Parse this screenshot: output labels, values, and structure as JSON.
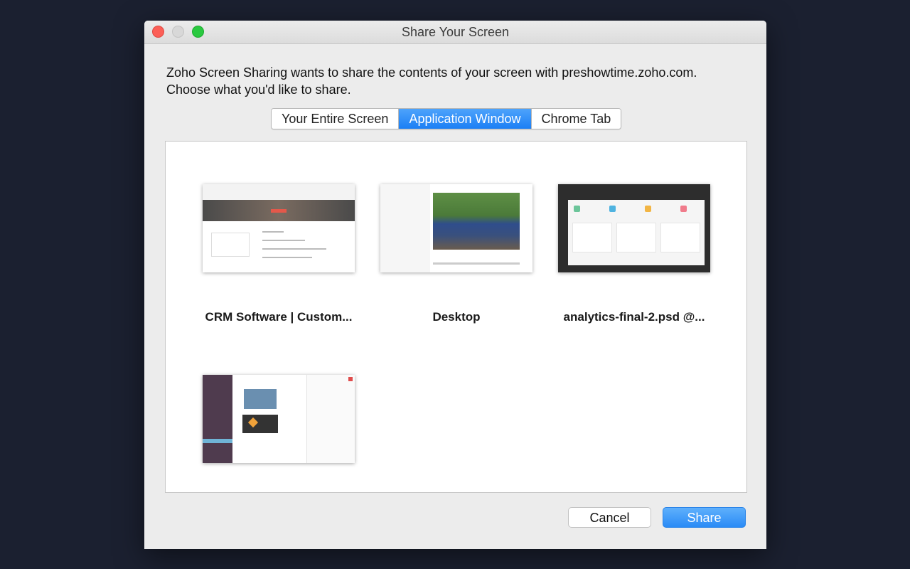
{
  "window": {
    "title": "Share Your Screen"
  },
  "message": {
    "line1": "Zoho Screen Sharing wants to share the contents of your screen with preshowtime.zoho.com.",
    "line2": "Choose what you'd like to share."
  },
  "tabs": [
    {
      "label": "Your Entire Screen",
      "selected": false
    },
    {
      "label": "Application Window",
      "selected": true
    },
    {
      "label": "Chrome Tab",
      "selected": false
    }
  ],
  "windows": [
    {
      "caption": "CRM Software | Custom..."
    },
    {
      "caption": "Desktop"
    },
    {
      "caption": "analytics-final-2.psd @..."
    },
    {
      "caption": ""
    }
  ],
  "buttons": {
    "cancel": "Cancel",
    "share": "Share"
  },
  "colors": {
    "accent": "#1b7ff5",
    "background": "#1b2030"
  },
  "icons": {
    "close": "close-icon",
    "minimize": "minimize-icon",
    "zoom": "zoom-icon"
  }
}
